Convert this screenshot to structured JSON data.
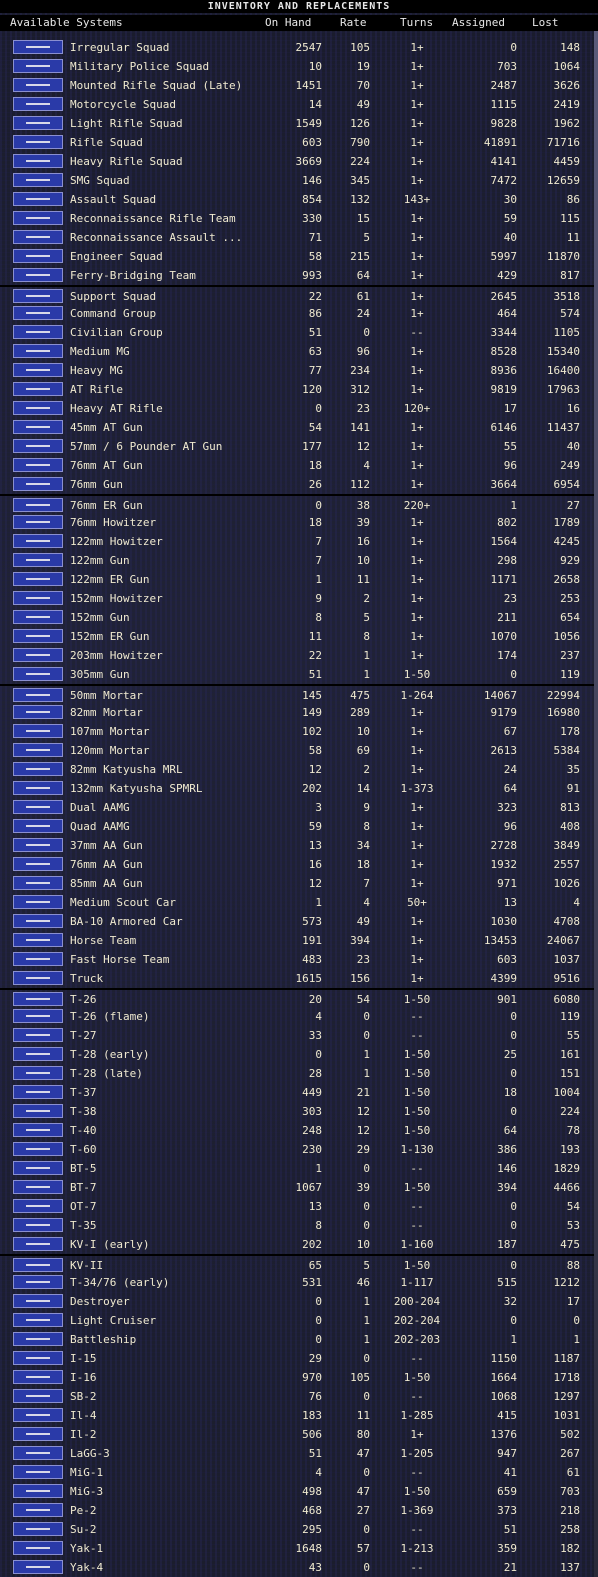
{
  "title": "INVENTORY AND REPLACEMENTS",
  "columns": {
    "name": "Available Systems",
    "onhand": "On Hand",
    "rate": "Rate",
    "turns": "Turns",
    "assigned": "Assigned",
    "lost": "Lost"
  },
  "colors": {
    "text": "#f0ead0",
    "icon_bg": "#2a3aa8",
    "background": "#1a1c2c"
  },
  "rows": [
    {
      "name": "Irregular Squad",
      "onhand": "2547",
      "rate": "105",
      "turns": "1+",
      "assigned": "0",
      "lost": "148",
      "icon": "rifle-icon"
    },
    {
      "name": "Military Police Squad",
      "onhand": "10",
      "rate": "19",
      "turns": "1+",
      "assigned": "703",
      "lost": "1064",
      "icon": "rifle-icon"
    },
    {
      "name": "Mounted Rifle Squad (Late)",
      "onhand": "1451",
      "rate": "70",
      "turns": "1+",
      "assigned": "2487",
      "lost": "3626",
      "icon": "horse-icon"
    },
    {
      "name": "Motorcycle Squad",
      "onhand": "14",
      "rate": "49",
      "turns": "1+",
      "assigned": "1115",
      "lost": "2419",
      "icon": "motorcycle-icon"
    },
    {
      "name": "Light Rifle Squad",
      "onhand": "1549",
      "rate": "126",
      "turns": "1+",
      "assigned": "9828",
      "lost": "1962",
      "icon": "rifle-icon"
    },
    {
      "name": "Rifle Squad",
      "onhand": "603",
      "rate": "790",
      "turns": "1+",
      "assigned": "41891",
      "lost": "71716",
      "icon": "rifle-icon"
    },
    {
      "name": "Heavy Rifle Squad",
      "onhand": "3669",
      "rate": "224",
      "turns": "1+",
      "assigned": "4141",
      "lost": "4459",
      "icon": "rifle-icon"
    },
    {
      "name": "SMG Squad",
      "onhand": "146",
      "rate": "345",
      "turns": "1+",
      "assigned": "7472",
      "lost": "12659",
      "icon": "smg-icon"
    },
    {
      "name": "Assault Squad",
      "onhand": "854",
      "rate": "132",
      "turns": "143+",
      "assigned": "30",
      "lost": "86",
      "icon": "smg-icon"
    },
    {
      "name": "Reconnaissance Rifle Team",
      "onhand": "330",
      "rate": "15",
      "turns": "1+",
      "assigned": "59",
      "lost": "115",
      "icon": "rifle-icon"
    },
    {
      "name": "Reconnaissance Assault ...",
      "onhand": "71",
      "rate": "5",
      "turns": "1+",
      "assigned": "40",
      "lost": "11",
      "icon": "smg-icon"
    },
    {
      "name": "Engineer Squad",
      "onhand": "58",
      "rate": "215",
      "turns": "1+",
      "assigned": "5997",
      "lost": "11870",
      "icon": "rifle-icon"
    },
    {
      "name": "Ferry-Bridging Team",
      "onhand": "993",
      "rate": "64",
      "turns": "1+",
      "assigned": "429",
      "lost": "817",
      "icon": "rifle-icon"
    },
    {
      "name": "Support Squad",
      "onhand": "22",
      "rate": "61",
      "turns": "1+",
      "assigned": "2645",
      "lost": "3518",
      "icon": "soldier-icon",
      "sep": true
    },
    {
      "name": "Command Group",
      "onhand": "86",
      "rate": "24",
      "turns": "1+",
      "assigned": "464",
      "lost": "574",
      "icon": "soldier-icon"
    },
    {
      "name": "Civilian Group",
      "onhand": "51",
      "rate": "0",
      "turns": "--",
      "assigned": "3344",
      "lost": "1105",
      "icon": "soldier-icon"
    },
    {
      "name": "Medium MG",
      "onhand": "63",
      "rate": "96",
      "turns": "1+",
      "assigned": "8528",
      "lost": "15340",
      "icon": "machine-gun-icon"
    },
    {
      "name": "Heavy MG",
      "onhand": "77",
      "rate": "234",
      "turns": "1+",
      "assigned": "8936",
      "lost": "16400",
      "icon": "machine-gun-icon"
    },
    {
      "name": "AT Rifle",
      "onhand": "120",
      "rate": "312",
      "turns": "1+",
      "assigned": "9819",
      "lost": "17963",
      "icon": "rifle-icon"
    },
    {
      "name": "Heavy AT Rifle",
      "onhand": "0",
      "rate": "23",
      "turns": "120+",
      "assigned": "17",
      "lost": "16",
      "icon": "rifle-icon"
    },
    {
      "name": "45mm AT Gun",
      "onhand": "54",
      "rate": "141",
      "turns": "1+",
      "assigned": "6146",
      "lost": "11437",
      "icon": "gun-icon"
    },
    {
      "name": "57mm / 6 Pounder AT Gun",
      "onhand": "177",
      "rate": "12",
      "turns": "1+",
      "assigned": "55",
      "lost": "40",
      "icon": "gun-icon"
    },
    {
      "name": "76mm AT Gun",
      "onhand": "18",
      "rate": "4",
      "turns": "1+",
      "assigned": "96",
      "lost": "249",
      "icon": "gun-icon"
    },
    {
      "name": "76mm Gun",
      "onhand": "26",
      "rate": "112",
      "turns": "1+",
      "assigned": "3664",
      "lost": "6954",
      "icon": "gun-icon"
    },
    {
      "name": "76mm ER Gun",
      "onhand": "0",
      "rate": "38",
      "turns": "220+",
      "assigned": "1",
      "lost": "27",
      "icon": "gun-icon",
      "sep": true
    },
    {
      "name": "76mm Howitzer",
      "onhand": "18",
      "rate": "39",
      "turns": "1+",
      "assigned": "802",
      "lost": "1789",
      "icon": "gun-icon"
    },
    {
      "name": "122mm Howitzer",
      "onhand": "7",
      "rate": "16",
      "turns": "1+",
      "assigned": "1564",
      "lost": "4245",
      "icon": "gun-icon"
    },
    {
      "name": "122mm Gun",
      "onhand": "7",
      "rate": "10",
      "turns": "1+",
      "assigned": "298",
      "lost": "929",
      "icon": "gun-icon"
    },
    {
      "name": "122mm ER Gun",
      "onhand": "1",
      "rate": "11",
      "turns": "1+",
      "assigned": "1171",
      "lost": "2658",
      "icon": "gun-icon"
    },
    {
      "name": "152mm Howitzer",
      "onhand": "9",
      "rate": "2",
      "turns": "1+",
      "assigned": "23",
      "lost": "253",
      "icon": "gun-icon"
    },
    {
      "name": "152mm Gun",
      "onhand": "8",
      "rate": "5",
      "turns": "1+",
      "assigned": "211",
      "lost": "654",
      "icon": "gun-icon"
    },
    {
      "name": "152mm ER Gun",
      "onhand": "11",
      "rate": "8",
      "turns": "1+",
      "assigned": "1070",
      "lost": "1056",
      "icon": "gun-icon"
    },
    {
      "name": "203mm Howitzer",
      "onhand": "22",
      "rate": "1",
      "turns": "1+",
      "assigned": "174",
      "lost": "237",
      "icon": "gun-icon"
    },
    {
      "name": "305mm Gun",
      "onhand": "51",
      "rate": "1",
      "turns": "1-50",
      "assigned": "0",
      "lost": "119",
      "icon": "gun-icon"
    },
    {
      "name": "50mm Mortar",
      "onhand": "145",
      "rate": "475",
      "turns": "1-264",
      "assigned": "14067",
      "lost": "22994",
      "icon": "mortar-icon",
      "sep": true
    },
    {
      "name": "82mm Mortar",
      "onhand": "149",
      "rate": "289",
      "turns": "1+",
      "assigned": "9179",
      "lost": "16980",
      "icon": "mortar-icon"
    },
    {
      "name": "107mm Mortar",
      "onhand": "102",
      "rate": "10",
      "turns": "1+",
      "assigned": "67",
      "lost": "178",
      "icon": "mortar-icon"
    },
    {
      "name": "120mm Mortar",
      "onhand": "58",
      "rate": "69",
      "turns": "1+",
      "assigned": "2613",
      "lost": "5384",
      "icon": "mortar-icon"
    },
    {
      "name": "82mm Katyusha MRL",
      "onhand": "12",
      "rate": "2",
      "turns": "1+",
      "assigned": "24",
      "lost": "35",
      "icon": "rocket-launcher-icon"
    },
    {
      "name": "132mm Katyusha SPMRL",
      "onhand": "202",
      "rate": "14",
      "turns": "1-373",
      "assigned": "64",
      "lost": "91",
      "icon": "rocket-launcher-icon"
    },
    {
      "name": "Dual AAMG",
      "onhand": "3",
      "rate": "9",
      "turns": "1+",
      "assigned": "323",
      "lost": "813",
      "icon": "aa-gun-icon"
    },
    {
      "name": "Quad AAMG",
      "onhand": "59",
      "rate": "8",
      "turns": "1+",
      "assigned": "96",
      "lost": "408",
      "icon": "aa-gun-icon"
    },
    {
      "name": "37mm AA Gun",
      "onhand": "13",
      "rate": "34",
      "turns": "1+",
      "assigned": "2728",
      "lost": "3849",
      "icon": "aa-gun-icon"
    },
    {
      "name": "76mm AA Gun",
      "onhand": "16",
      "rate": "18",
      "turns": "1+",
      "assigned": "1932",
      "lost": "2557",
      "icon": "aa-gun-icon"
    },
    {
      "name": "85mm AA Gun",
      "onhand": "12",
      "rate": "7",
      "turns": "1+",
      "assigned": "971",
      "lost": "1026",
      "icon": "aa-gun-icon"
    },
    {
      "name": "Medium Scout Car",
      "onhand": "1",
      "rate": "4",
      "turns": "50+",
      "assigned": "13",
      "lost": "4",
      "icon": "scout-car-icon"
    },
    {
      "name": "BA-10 Armored Car",
      "onhand": "573",
      "rate": "49",
      "turns": "1+",
      "assigned": "1030",
      "lost": "4708",
      "icon": "armored-car-icon"
    },
    {
      "name": "Horse Team",
      "onhand": "191",
      "rate": "394",
      "turns": "1+",
      "assigned": "13453",
      "lost": "24067",
      "icon": "horse-icon"
    },
    {
      "name": "Fast Horse Team",
      "onhand": "483",
      "rate": "23",
      "turns": "1+",
      "assigned": "603",
      "lost": "1037",
      "icon": "horse-icon"
    },
    {
      "name": "Truck",
      "onhand": "1615",
      "rate": "156",
      "turns": "1+",
      "assigned": "4399",
      "lost": "9516",
      "icon": "truck-icon"
    },
    {
      "name": "T-26",
      "onhand": "20",
      "rate": "54",
      "turns": "1-50",
      "assigned": "901",
      "lost": "6080",
      "icon": "tank-icon",
      "sep": true
    },
    {
      "name": "T-26 (flame)",
      "onhand": "4",
      "rate": "0",
      "turns": "--",
      "assigned": "0",
      "lost": "119",
      "icon": "tank-icon"
    },
    {
      "name": "T-27",
      "onhand": "33",
      "rate": "0",
      "turns": "--",
      "assigned": "0",
      "lost": "55",
      "icon": "tank-icon"
    },
    {
      "name": "T-28 (early)",
      "onhand": "0",
      "rate": "1",
      "turns": "1-50",
      "assigned": "25",
      "lost": "161",
      "icon": "tank-icon"
    },
    {
      "name": "T-28 (late)",
      "onhand": "28",
      "rate": "1",
      "turns": "1-50",
      "assigned": "0",
      "lost": "151",
      "icon": "tank-icon"
    },
    {
      "name": "T-37",
      "onhand": "449",
      "rate": "21",
      "turns": "1-50",
      "assigned": "18",
      "lost": "1004",
      "icon": "tank-icon"
    },
    {
      "name": "T-38",
      "onhand": "303",
      "rate": "12",
      "turns": "1-50",
      "assigned": "0",
      "lost": "224",
      "icon": "tank-icon"
    },
    {
      "name": "T-40",
      "onhand": "248",
      "rate": "12",
      "turns": "1-50",
      "assigned": "64",
      "lost": "78",
      "icon": "tank-icon"
    },
    {
      "name": "T-60",
      "onhand": "230",
      "rate": "29",
      "turns": "1-130",
      "assigned": "386",
      "lost": "193",
      "icon": "tank-icon"
    },
    {
      "name": "BT-5",
      "onhand": "1",
      "rate": "0",
      "turns": "--",
      "assigned": "146",
      "lost": "1829",
      "icon": "tank-icon"
    },
    {
      "name": "BT-7",
      "onhand": "1067",
      "rate": "39",
      "turns": "1-50",
      "assigned": "394",
      "lost": "4466",
      "icon": "tank-icon"
    },
    {
      "name": "OT-7",
      "onhand": "13",
      "rate": "0",
      "turns": "--",
      "assigned": "0",
      "lost": "54",
      "icon": "tank-icon"
    },
    {
      "name": "T-35",
      "onhand": "8",
      "rate": "0",
      "turns": "--",
      "assigned": "0",
      "lost": "53",
      "icon": "tank-icon"
    },
    {
      "name": "KV-I (early)",
      "onhand": "202",
      "rate": "10",
      "turns": "1-160",
      "assigned": "187",
      "lost": "475",
      "icon": "tank-icon"
    },
    {
      "name": "KV-II",
      "onhand": "65",
      "rate": "5",
      "turns": "1-50",
      "assigned": "0",
      "lost": "88",
      "icon": "tank-icon",
      "sep": true
    },
    {
      "name": "T-34/76 (early)",
      "onhand": "531",
      "rate": "46",
      "turns": "1-117",
      "assigned": "515",
      "lost": "1212",
      "icon": "tank-icon"
    },
    {
      "name": "Destroyer",
      "onhand": "0",
      "rate": "1",
      "turns": "200-204",
      "assigned": "32",
      "lost": "17",
      "icon": "ship-icon"
    },
    {
      "name": "Light Cruiser",
      "onhand": "0",
      "rate": "1",
      "turns": "202-204",
      "assigned": "0",
      "lost": "0",
      "icon": "ship-icon"
    },
    {
      "name": "Battleship",
      "onhand": "0",
      "rate": "1",
      "turns": "202-203",
      "assigned": "1",
      "lost": "1",
      "icon": "ship-icon"
    },
    {
      "name": "I-15",
      "onhand": "29",
      "rate": "0",
      "turns": "--",
      "assigned": "1150",
      "lost": "1187",
      "icon": "aircraft-icon"
    },
    {
      "name": "I-16",
      "onhand": "970",
      "rate": "105",
      "turns": "1-50",
      "assigned": "1664",
      "lost": "1718",
      "icon": "aircraft-icon"
    },
    {
      "name": "SB-2",
      "onhand": "76",
      "rate": "0",
      "turns": "--",
      "assigned": "1068",
      "lost": "1297",
      "icon": "aircraft-icon"
    },
    {
      "name": "Il-4",
      "onhand": "183",
      "rate": "11",
      "turns": "1-285",
      "assigned": "415",
      "lost": "1031",
      "icon": "aircraft-icon"
    },
    {
      "name": "Il-2",
      "onhand": "506",
      "rate": "80",
      "turns": "1+",
      "assigned": "1376",
      "lost": "502",
      "icon": "aircraft-icon"
    },
    {
      "name": "LaGG-3",
      "onhand": "51",
      "rate": "47",
      "turns": "1-205",
      "assigned": "947",
      "lost": "267",
      "icon": "aircraft-icon"
    },
    {
      "name": "MiG-1",
      "onhand": "4",
      "rate": "0",
      "turns": "--",
      "assigned": "41",
      "lost": "61",
      "icon": "aircraft-icon"
    },
    {
      "name": "MiG-3",
      "onhand": "498",
      "rate": "47",
      "turns": "1-50",
      "assigned": "659",
      "lost": "703",
      "icon": "aircraft-icon"
    },
    {
      "name": "Pe-2",
      "onhand": "468",
      "rate": "27",
      "turns": "1-369",
      "assigned": "373",
      "lost": "218",
      "icon": "aircraft-icon"
    },
    {
      "name": "Su-2",
      "onhand": "295",
      "rate": "0",
      "turns": "--",
      "assigned": "51",
      "lost": "258",
      "icon": "aircraft-icon"
    },
    {
      "name": "Yak-1",
      "onhand": "1648",
      "rate": "57",
      "turns": "1-213",
      "assigned": "359",
      "lost": "182",
      "icon": "aircraft-icon"
    },
    {
      "name": "Yak-4",
      "onhand": "43",
      "rate": "0",
      "turns": "--",
      "assigned": "21",
      "lost": "137",
      "icon": "aircraft-icon"
    }
  ]
}
